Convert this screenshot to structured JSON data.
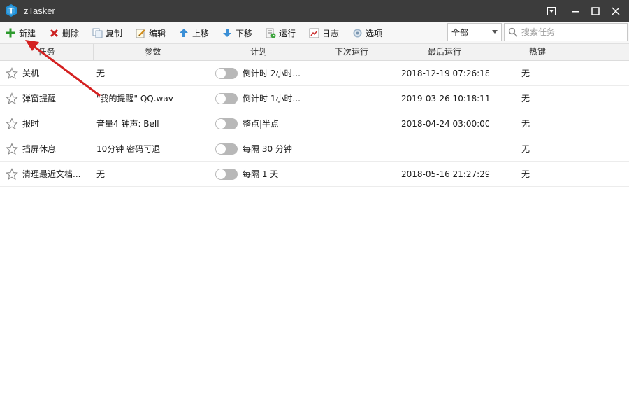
{
  "window": {
    "title": "zTasker",
    "logo_letter": "T",
    "controls": [
      "menu-icon",
      "minimize-icon",
      "maximize-icon",
      "close-icon"
    ]
  },
  "toolbar": {
    "items": [
      {
        "label": "新建",
        "icon": "plus-icon"
      },
      {
        "label": "删除",
        "icon": "delete-x-icon"
      },
      {
        "label": "复制",
        "icon": "copy-icon"
      },
      {
        "label": "编辑",
        "icon": "edit-icon"
      },
      {
        "label": "上移",
        "icon": "arrow-up-icon"
      },
      {
        "label": "下移",
        "icon": "arrow-down-icon"
      },
      {
        "label": "运行",
        "icon": "run-icon"
      },
      {
        "label": "日志",
        "icon": "log-icon"
      },
      {
        "label": "选项",
        "icon": "gear-icon"
      }
    ],
    "filter": {
      "selected": "全部"
    },
    "search": {
      "placeholder": "搜索任务",
      "value": ""
    }
  },
  "table": {
    "columns": [
      "任务",
      "参数",
      "计划",
      "下次运行",
      "最后运行",
      "热键"
    ],
    "rows": [
      {
        "task": "关机",
        "params": "无",
        "enabled": false,
        "schedule": "倒计时 2小时...",
        "next_run": "",
        "last_run": "2018-12-19 07:26:18",
        "hotkey": "无"
      },
      {
        "task": "弹窗提醒",
        "params": "\"我的提醒\" QQ.wav",
        "enabled": false,
        "schedule": "倒计时 1小时...",
        "next_run": "",
        "last_run": "2019-03-26 10:18:11",
        "hotkey": "无"
      },
      {
        "task": "报时",
        "params": "音量4 钟声: Bell",
        "enabled": false,
        "schedule": "整点|半点",
        "next_run": "",
        "last_run": "2018-04-24 03:00:00",
        "hotkey": "无"
      },
      {
        "task": "挡屏休息",
        "params": "10分钟 密码可退",
        "enabled": false,
        "schedule": "每隔 30 分钟",
        "next_run": "",
        "last_run": "",
        "hotkey": "无"
      },
      {
        "task": "清理最近文档...",
        "params": "无",
        "enabled": false,
        "schedule": "每隔 1 天",
        "next_run": "",
        "last_run": "2018-05-16 21:27:29",
        "hotkey": "无"
      }
    ]
  },
  "colors": {
    "titlebar": "#3c3c3c",
    "logo_blue": "#1e90d8",
    "annotation_arrow": "#d42020",
    "toggle_off": "#b8b8b8"
  }
}
